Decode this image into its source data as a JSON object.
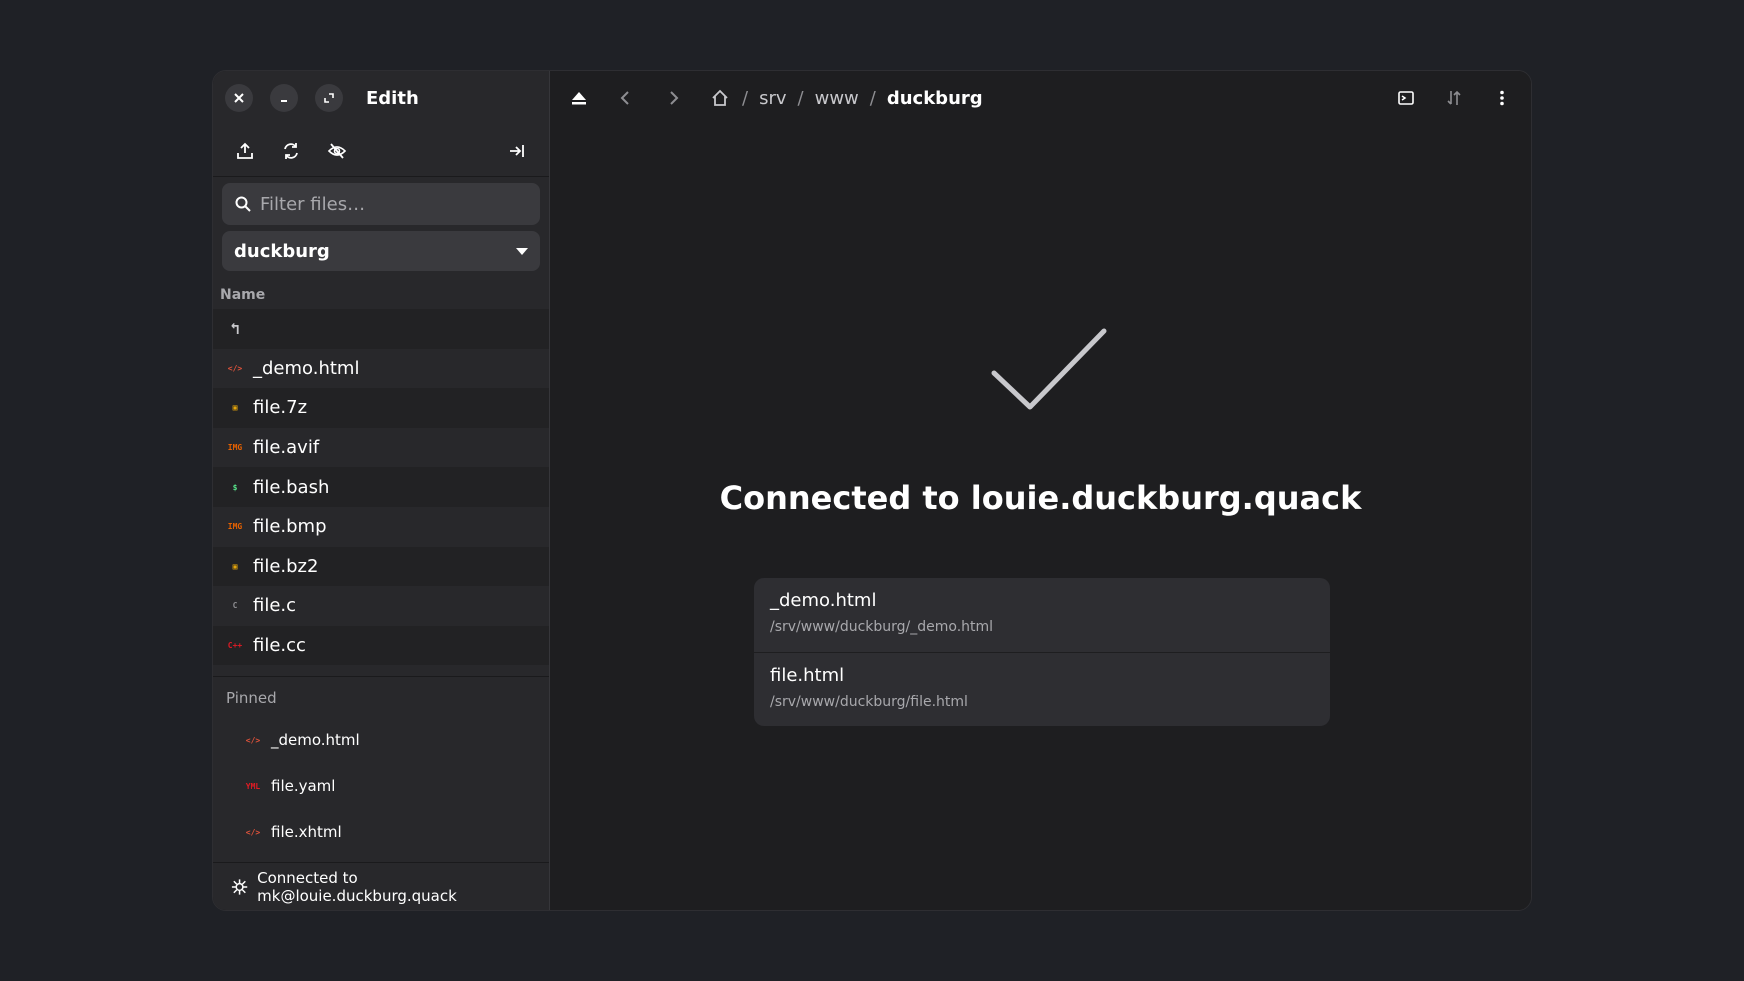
{
  "window": {
    "title": "Edith"
  },
  "sidebar": {
    "search_placeholder": "Filter files…",
    "location": "duckburg",
    "column_name": "Name",
    "files": [
      {
        "name": "",
        "icon": "parent-dir-icon",
        "icon_text": "↰",
        "color": "#c8c8cc"
      },
      {
        "name": "_demo.html",
        "icon": "html-icon",
        "icon_text": "</>",
        "color": "#e0533b"
      },
      {
        "name": "file.7z",
        "icon": "archive-icon",
        "icon_text": "▣",
        "color": "#e5a50a"
      },
      {
        "name": "file.avif",
        "icon": "image-icon",
        "icon_text": "IMG",
        "color": "#e66100"
      },
      {
        "name": "file.bash",
        "icon": "shell-icon",
        "icon_text": "$",
        "color": "#57e389"
      },
      {
        "name": "file.bmp",
        "icon": "image-icon",
        "icon_text": "IMG",
        "color": "#e66100"
      },
      {
        "name": "file.bz2",
        "icon": "archive-icon",
        "icon_text": "▣",
        "color": "#e5a50a"
      },
      {
        "name": "file.c",
        "icon": "c-icon",
        "icon_text": "C",
        "color": "#8e8e92"
      },
      {
        "name": "file.cc",
        "icon": "cpp-icon",
        "icon_text": "C++",
        "color": "#e01b24"
      }
    ],
    "pinned_label": "Pinned",
    "pinned": [
      {
        "name": "_demo.html",
        "icon": "html-icon",
        "icon_text": "</>",
        "color": "#e0533b"
      },
      {
        "name": "file.yaml",
        "icon": "yaml-icon",
        "icon_text": "YML",
        "color": "#e01b24"
      },
      {
        "name": "file.xhtml",
        "icon": "html-icon",
        "icon_text": "</>",
        "color": "#e0533b"
      }
    ],
    "status": "Connected to mk@louie.duckburg.quack"
  },
  "header": {
    "breadcrumbs": [
      "srv",
      "www",
      "duckburg"
    ]
  },
  "main": {
    "heading": "Connected to louie.duckburg.quack",
    "recents": [
      {
        "name": "_demo.html",
        "path": "/srv/www/duckburg/_demo.html"
      },
      {
        "name": "file.html",
        "path": "/srv/www/duckburg/file.html"
      }
    ]
  }
}
